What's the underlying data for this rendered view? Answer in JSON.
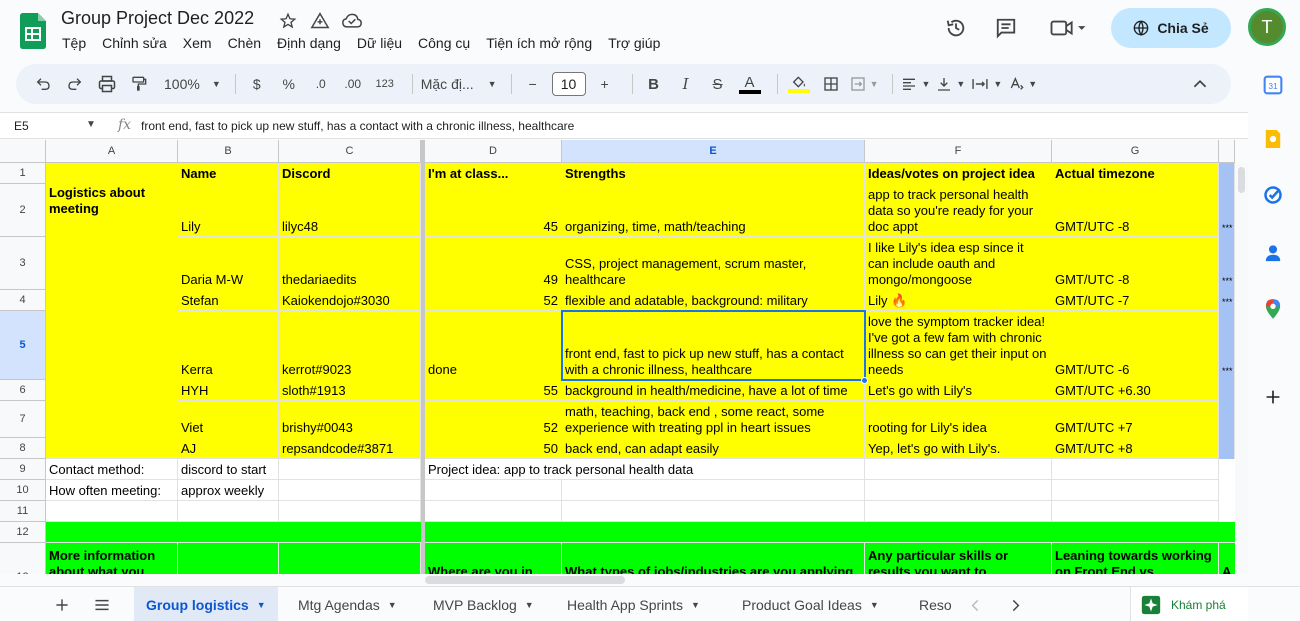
{
  "app": {
    "doc_title": "Group Project Dec 2022",
    "menu": [
      "Tệp",
      "Chỉnh sửa",
      "Xem",
      "Chèn",
      "Định dạng",
      "Dữ liệu",
      "Công cụ",
      "Tiện ích mở rộng",
      "Trợ giúp"
    ],
    "share_label": "Chia Sẻ",
    "avatar_letter": "T"
  },
  "toolbar": {
    "zoom": "100%",
    "currency": "$",
    "percent": "%",
    "dec_decrease": ".0",
    "dec_increase": ".00",
    "number_format": "123",
    "font": "Mặc đị...",
    "font_size": "10"
  },
  "formula_bar": {
    "cell_ref": "E5",
    "fx": "fx",
    "content": "front end, fast to pick up new stuff, has a contact with a chronic illness, healthcare"
  },
  "grid": {
    "columns": [
      "A",
      "B",
      "C",
      "D",
      "E",
      "F",
      "G"
    ],
    "rows": [
      "1",
      "2",
      "3",
      "4",
      "5",
      "6",
      "7",
      "8",
      "9",
      "10",
      "11",
      "12",
      "13"
    ],
    "header": {
      "name": "Name",
      "discord": "Discord",
      "class": "I'm at class...",
      "strengths": "Strengths",
      "ideas": "Ideas/votes on project idea",
      "timezone": "Actual timezone"
    },
    "logistics_label": "Logistics about meeting",
    "members": [
      {
        "name": "Lily",
        "discord": "lilyc48",
        "class": "45",
        "strengths": "organizing, time, math/teaching",
        "idea": "app to track personal health data so you're ready for your doc appt",
        "tz": "GMT/UTC -8"
      },
      {
        "name": "Daria M-W",
        "discord": "thedariaedits",
        "class": "49",
        "strengths": "CSS, project management, scrum master, healthcare",
        "idea": "I like Lily's idea esp since it can include oauth and mongo/mongoose",
        "tz": "GMT/UTC -8"
      },
      {
        "name": "Stefan",
        "discord": "Kaiokendojo#3030",
        "class": "52",
        "strengths": "flexible and adatable, background: military",
        "idea": "Lily 🔥",
        "tz": "GMT/UTC -7"
      },
      {
        "name": "Kerra",
        "discord": "kerrot#9023",
        "class": "done",
        "strengths": "front end, fast to pick up new stuff, has a contact with a chronic illness, healthcare",
        "idea": "love the symptom tracker idea! I've got a few fam with chronic illness so can get their input on needs",
        "tz": "GMT/UTC -6"
      },
      {
        "name": "HYH",
        "discord": "sloth#1913",
        "class": "55",
        "strengths": "background in health/medicine, have a lot of time",
        "idea": "Let's go with Lily's",
        "tz": "GMT/UTC +6.30"
      },
      {
        "name": "Viet",
        "discord": "brishy#0043",
        "class": "52",
        "strengths": "math, teaching, back end , some react, some experience with treating ppl in heart issues",
        "idea": "rooting for Lily's idea",
        "tz": "GMT/UTC +7"
      },
      {
        "name": "AJ",
        "discord": "repsandcode#3871",
        "class": "50",
        "strengths": " back end, can adapt easily",
        "idea": "Yep, let's go with Lily's.",
        "tz": "GMT/UTC +8"
      }
    ],
    "overflow_marks": [
      "***",
      "***",
      "***",
      "***"
    ],
    "contact_label": "Contact method:",
    "contact_value": "discord to start",
    "project_idea": "Project idea: app to track personal health data",
    "meeting_label": "How often meeting:",
    "meeting_value": "approx weekly",
    "row13": {
      "a": "More information about what you",
      "d": "Where are you in",
      "e": "What types of jobs/industries are you applying",
      "f": "Any particular skills or results you want to",
      "g": "Leaning towards working on Front End vs",
      "h": "A"
    }
  },
  "sheets": {
    "tabs": [
      "Group logistics",
      "Mtg Agendas",
      "MVP Backlog",
      "Health App Sprints",
      "Product Goal Ideas",
      "Reso"
    ],
    "active": 0,
    "explore_label": "Khám phá"
  },
  "colors": {
    "yellow": "#ffff00",
    "green": "#00ff00",
    "selection": "#1a73e8",
    "share_bg": "#c2e7ff"
  }
}
